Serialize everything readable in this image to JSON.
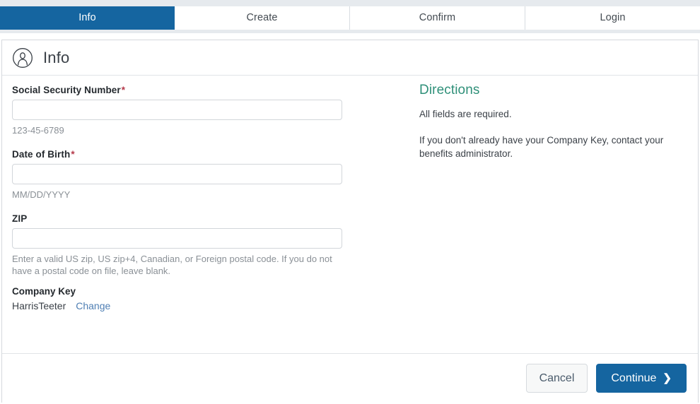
{
  "tabs": [
    {
      "label": "Info",
      "active": true
    },
    {
      "label": "Create",
      "active": false
    },
    {
      "label": "Confirm",
      "active": false
    },
    {
      "label": "Login",
      "active": false
    }
  ],
  "header": {
    "icon": "user-circle-icon",
    "title": "Info"
  },
  "form": {
    "ssn": {
      "label": "Social Security Number",
      "required_marker": "*",
      "value": "",
      "placeholder": "",
      "helper": "123-45-6789"
    },
    "dob": {
      "label": "Date of Birth",
      "required_marker": "*",
      "value": "",
      "placeholder": "",
      "helper": "MM/DD/YYYY"
    },
    "zip": {
      "label": "ZIP",
      "value": "",
      "placeholder": "",
      "helper": "Enter a valid US zip, US zip+4, Canadian, or Foreign postal code. If you do not have a postal code on file, leave blank."
    },
    "company_key": {
      "label": "Company Key",
      "value": "HarrisTeeter",
      "change_label": "Change"
    }
  },
  "directions": {
    "title": "Directions",
    "paragraphs": [
      "All fields are required.",
      "If you don't already have your Company Key, contact your benefits administrator."
    ]
  },
  "footer": {
    "cancel_label": "Cancel",
    "continue_label": "Continue",
    "continue_icon": "chevron-right-icon",
    "continue_chevron": "❯"
  },
  "colors": {
    "accent_blue": "#1565a0",
    "tabstrip_bg": "#e6eaee",
    "directions_teal": "#2f9079",
    "required_red": "#b5394a",
    "link_blue": "#4f7fb4",
    "helper_gray": "#8a9096",
    "border_gray": "#d5d9dd"
  }
}
